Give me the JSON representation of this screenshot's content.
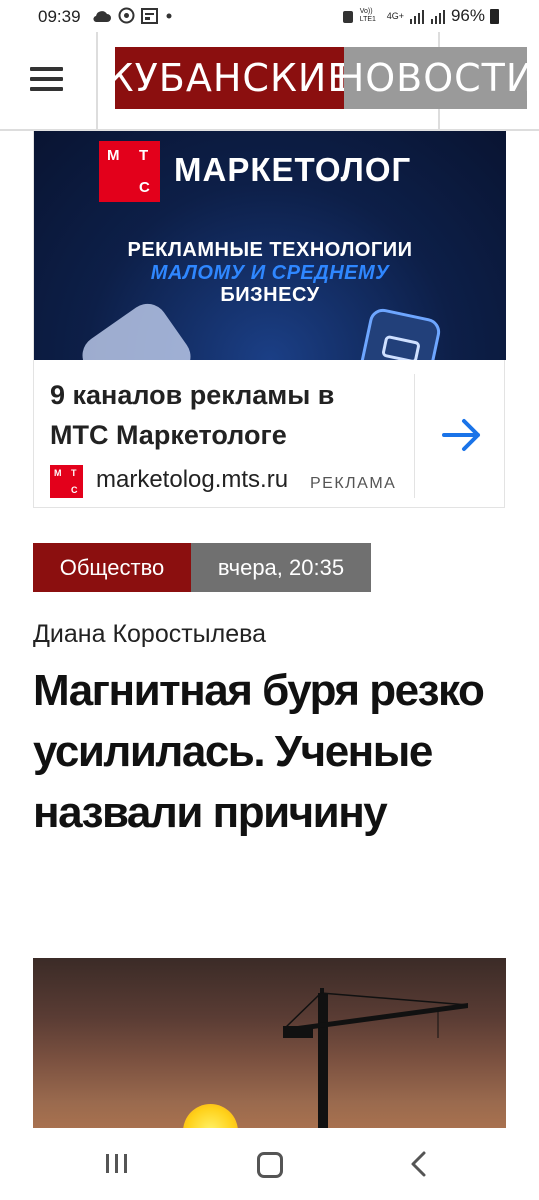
{
  "status_bar": {
    "time": "09:39",
    "battery": "96%",
    "network": "4G+",
    "volte": "Vo)) LTE1"
  },
  "header": {
    "logo_part1": "КУБАНСКИЕ",
    "logo_part2": "НОВОСТИ",
    "colors": {
      "logo_red": "#8b0f0f",
      "logo_gray": "#9a9a9a"
    }
  },
  "ad": {
    "banner_logo_letters": [
      "М",
      "Т",
      "С"
    ],
    "banner_title": "МАРКЕТОЛОГ",
    "banner_line1": "РЕКЛАМНЫЕ ТЕХНОЛОГИИ",
    "banner_line2": "МАЛОМУ И СРЕДНЕМУ",
    "banner_line3": "БИЗНЕСУ",
    "headline": "9 каналов рекламы в МТС Маркетологе",
    "domain": "marketolog.mts.ru",
    "label": "РЕКЛАМА",
    "arrow_icon": "arrow-right-icon"
  },
  "article": {
    "category": "Общество",
    "time": "вчера, 20:35",
    "author": "Диана Коростылева",
    "title": "Магнитная буря резко усилилась. Ученые назвали причину"
  },
  "navbar": {
    "recent_icon": "recent-apps-icon",
    "home_icon": "home-icon",
    "back_icon": "back-icon"
  }
}
